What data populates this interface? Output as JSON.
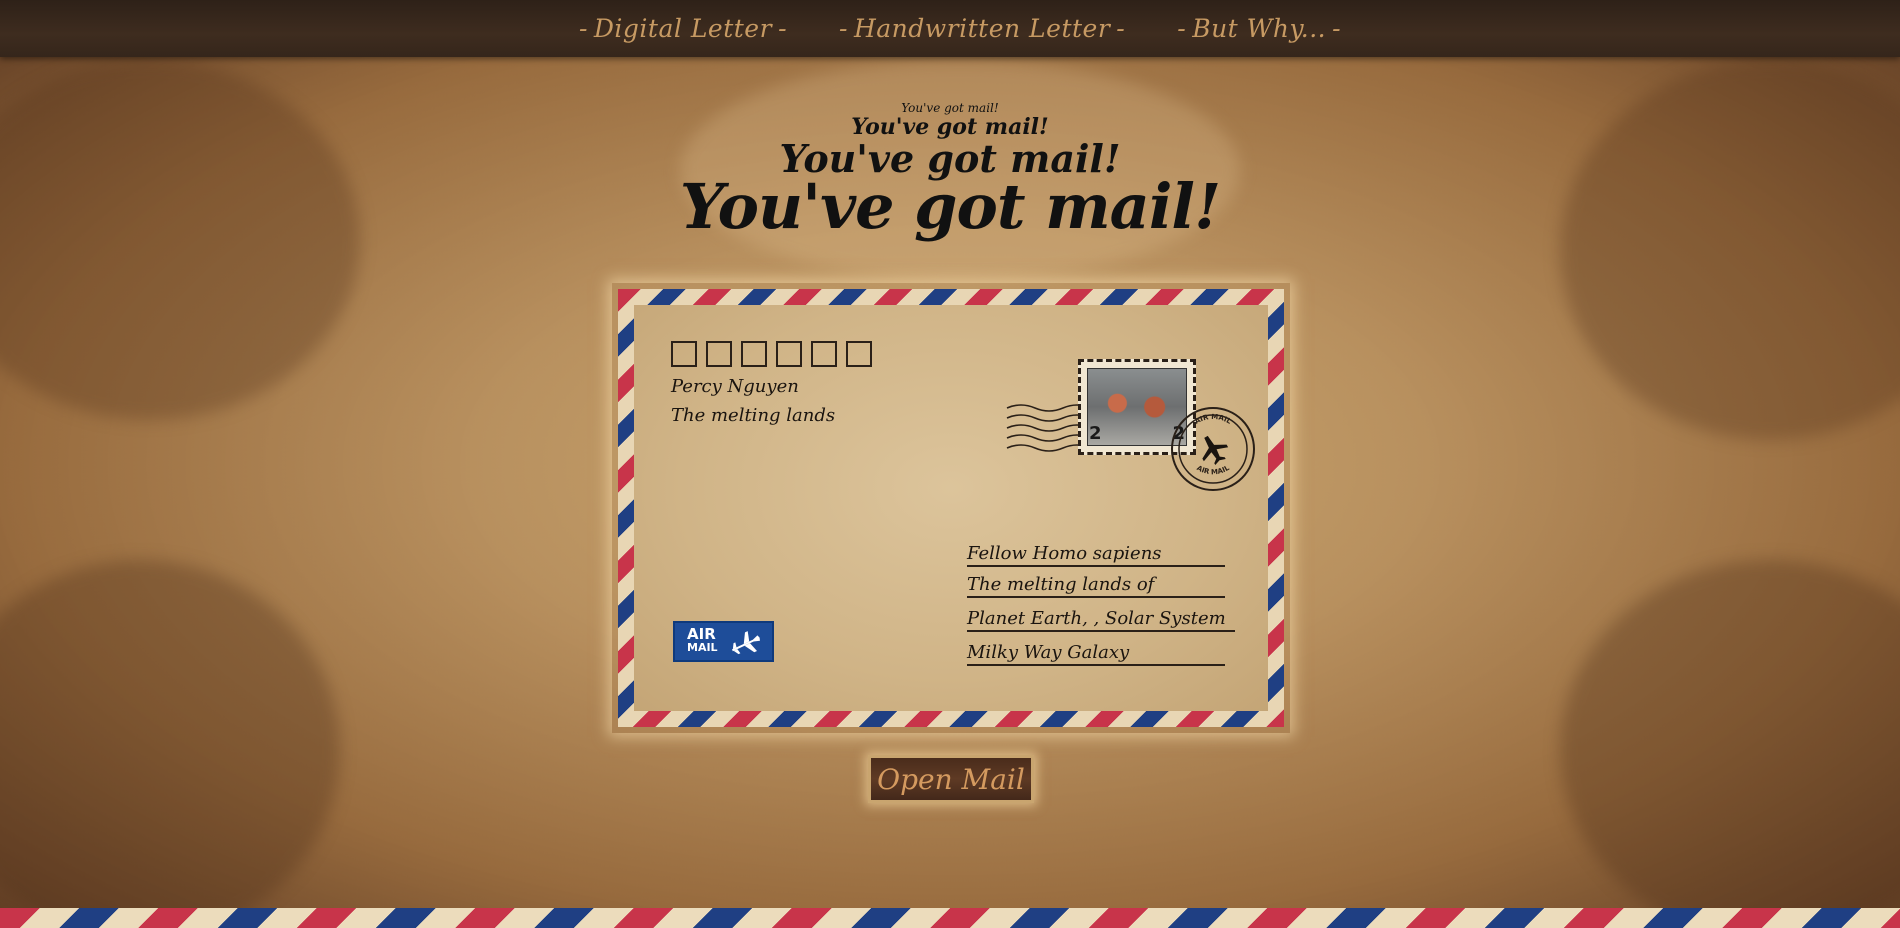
{
  "nav": {
    "items": [
      {
        "label": "Digital Letter"
      },
      {
        "label": "Handwritten Letter"
      },
      {
        "label": "But Why..."
      }
    ],
    "dash": "-"
  },
  "headline": {
    "line1": "You've got mail!",
    "line2": "You've got mail!",
    "line3": "You've got mail!",
    "line4": "You've got mail!"
  },
  "envelope": {
    "zip_box_count": 6,
    "sender": {
      "name": "Percy Nguyen",
      "place": "The melting lands"
    },
    "recipient": {
      "line1": "Fellow Homo sapiens",
      "line2": "The melting lands of",
      "line3": "Planet Earth, , Solar System",
      "line4": "Milky Way Galaxy"
    },
    "stamp": {
      "value": "2"
    },
    "postmark": {
      "text_top": "AIR MAIL",
      "text_bottom": "AIR MAIL",
      "icon": "airplane-icon"
    },
    "airmail_label": {
      "line1": "AIR",
      "line2": "MAIL",
      "icon": "airplane-icon"
    }
  },
  "open_button": {
    "label": "Open Mail"
  },
  "colors": {
    "nav_bg": "#35261b",
    "nav_text": "#c79a63",
    "stripe_red": "#c8344a",
    "stripe_blue": "#1f3f83",
    "airmail_blue": "#1e4d99",
    "button_text": "#d49a5f"
  }
}
